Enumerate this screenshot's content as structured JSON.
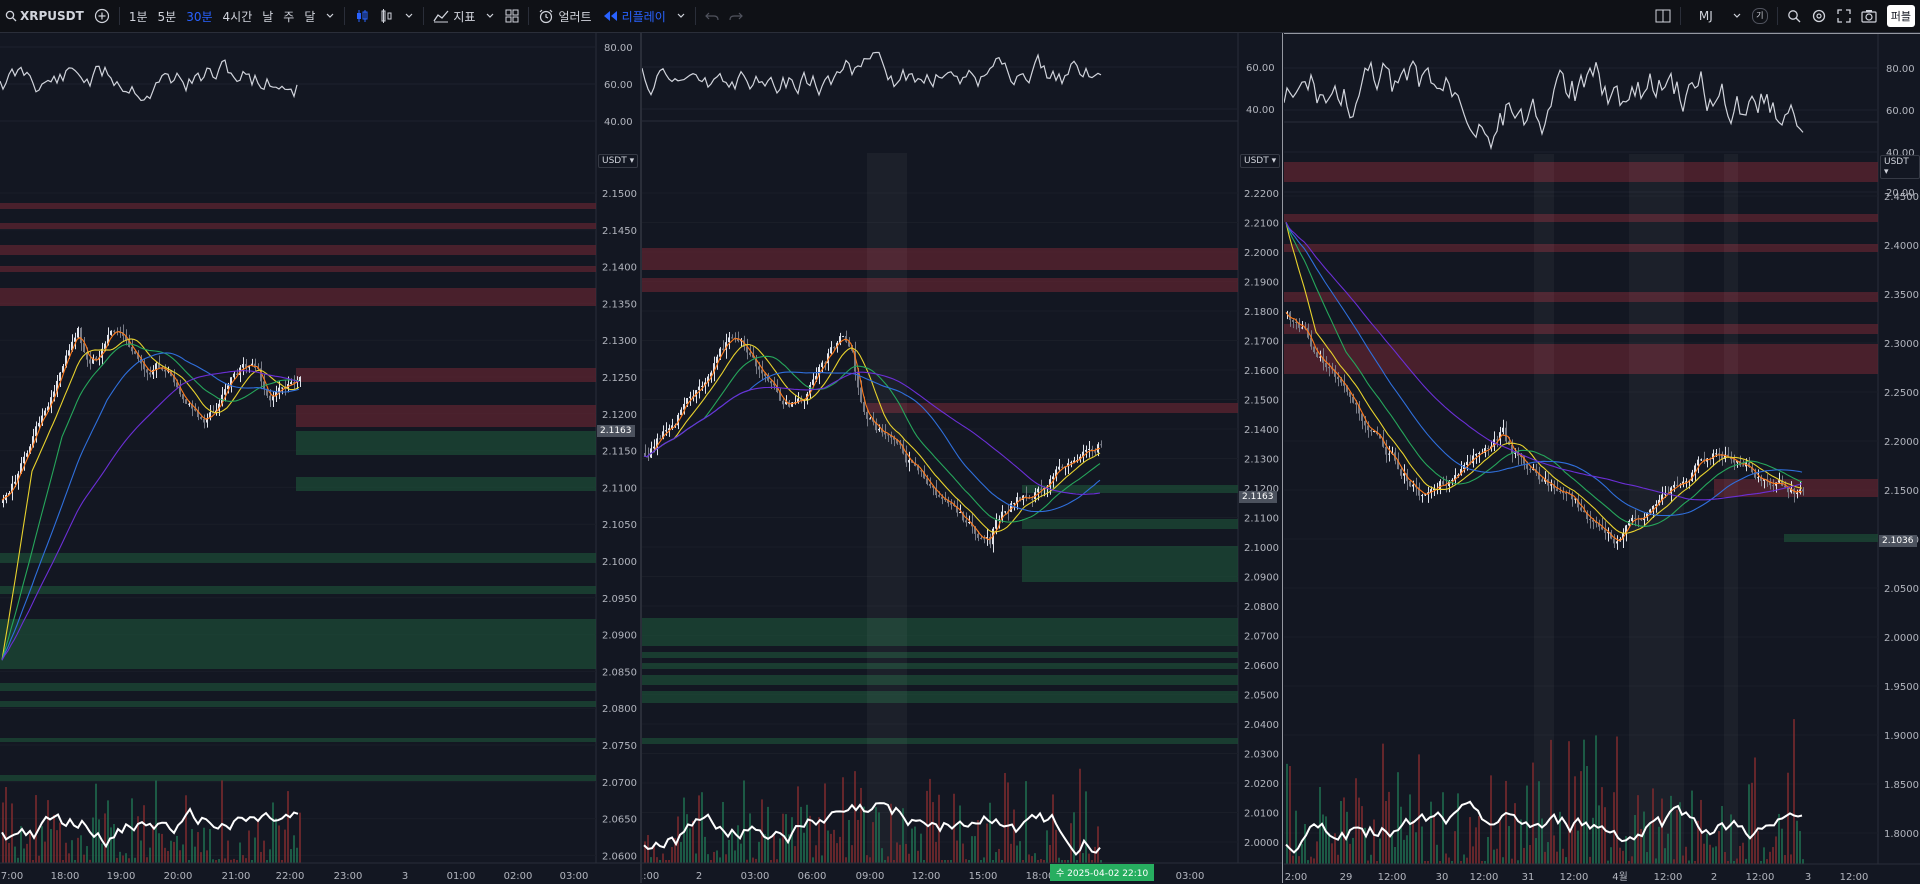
{
  "toolbar": {
    "symbol": "XRPUSDT",
    "intervals": [
      "1분",
      "5분",
      "30분",
      "4시간",
      "날",
      "주",
      "달"
    ],
    "active_interval": "30분",
    "indicators_label": "지표",
    "alert_label": "얼러트",
    "replay_label": "리플레이",
    "user_label": "MJ",
    "user_badge": "기",
    "publish_label": "퍼블"
  },
  "panes": [
    {
      "id": "left",
      "rsi_ticks": [
        "80.00",
        "60.00",
        "40.00"
      ],
      "price_ticks": [
        "2.1500",
        "2.1450",
        "2.1400",
        "2.1350",
        "2.1300",
        "2.1250",
        "2.1200",
        "2.1150",
        "2.1100",
        "2.1050",
        "2.1000",
        "2.0950",
        "2.0900",
        "2.0850",
        "2.0800",
        "2.0750",
        "2.0700",
        "2.0650",
        "2.0600"
      ],
      "currency": "USDT",
      "current_price": "2.1163",
      "time_ticks": [
        "7:00",
        "18:00",
        "19:00",
        "20:00",
        "21:00",
        "22:00",
        "23:00",
        "3",
        "01:00",
        "02:00",
        "03:00"
      ]
    },
    {
      "id": "middle",
      "rsi_ticks": [
        "60.00",
        "40.00"
      ],
      "price_ticks": [
        "2.2200",
        "2.2100",
        "2.2000",
        "2.1900",
        "2.1800",
        "2.1700",
        "2.1600",
        "2.1500",
        "2.1400",
        "2.1300",
        "2.1200",
        "2.1100",
        "2.1000",
        "2.0900",
        "2.0800",
        "2.0700",
        "2.0600",
        "2.0500",
        "2.0400",
        "2.0300",
        "2.0200",
        "2.0100",
        "2.0000"
      ],
      "currency": "USDT",
      "current_price": "2.1163",
      "time_ticks": [
        "1:00",
        "2",
        "03:00",
        "06:00",
        "09:00",
        "12:00",
        "15:00",
        "18:00",
        "03:00"
      ],
      "crosshair_time": "수  2025-04-02   22:10"
    },
    {
      "id": "right",
      "rsi_ticks": [
        "80.00",
        "60.00",
        "40.00",
        "20.00"
      ],
      "price_ticks": [
        "2.4500",
        "2.4000",
        "2.3500",
        "2.3000",
        "2.2500",
        "2.2000",
        "2.1500",
        "2.1000",
        "2.0500",
        "2.0000",
        "1.9500",
        "1.9000",
        "1.8500",
        "1.8000"
      ],
      "currency": "USDT",
      "current_price": "2.1036",
      "time_ticks": [
        "2:00",
        "29",
        "12:00",
        "30",
        "12:00",
        "31",
        "12:00",
        "4월",
        "12:00",
        "2",
        "12:00",
        "3",
        "12:00"
      ]
    }
  ],
  "colors": {
    "background": "#131722",
    "candle_up": "#e0e3eb",
    "candle_down": "#787b86",
    "resistance_zone": "#5c2430",
    "support_zone": "#1c4a36",
    "ma_orange": "#ff7a1a",
    "ma_yellow": "#e8d22d",
    "ma_green": "#26a65b",
    "ma_blue": "#2f6fdc",
    "ma_purple": "#6b2fd6"
  }
}
